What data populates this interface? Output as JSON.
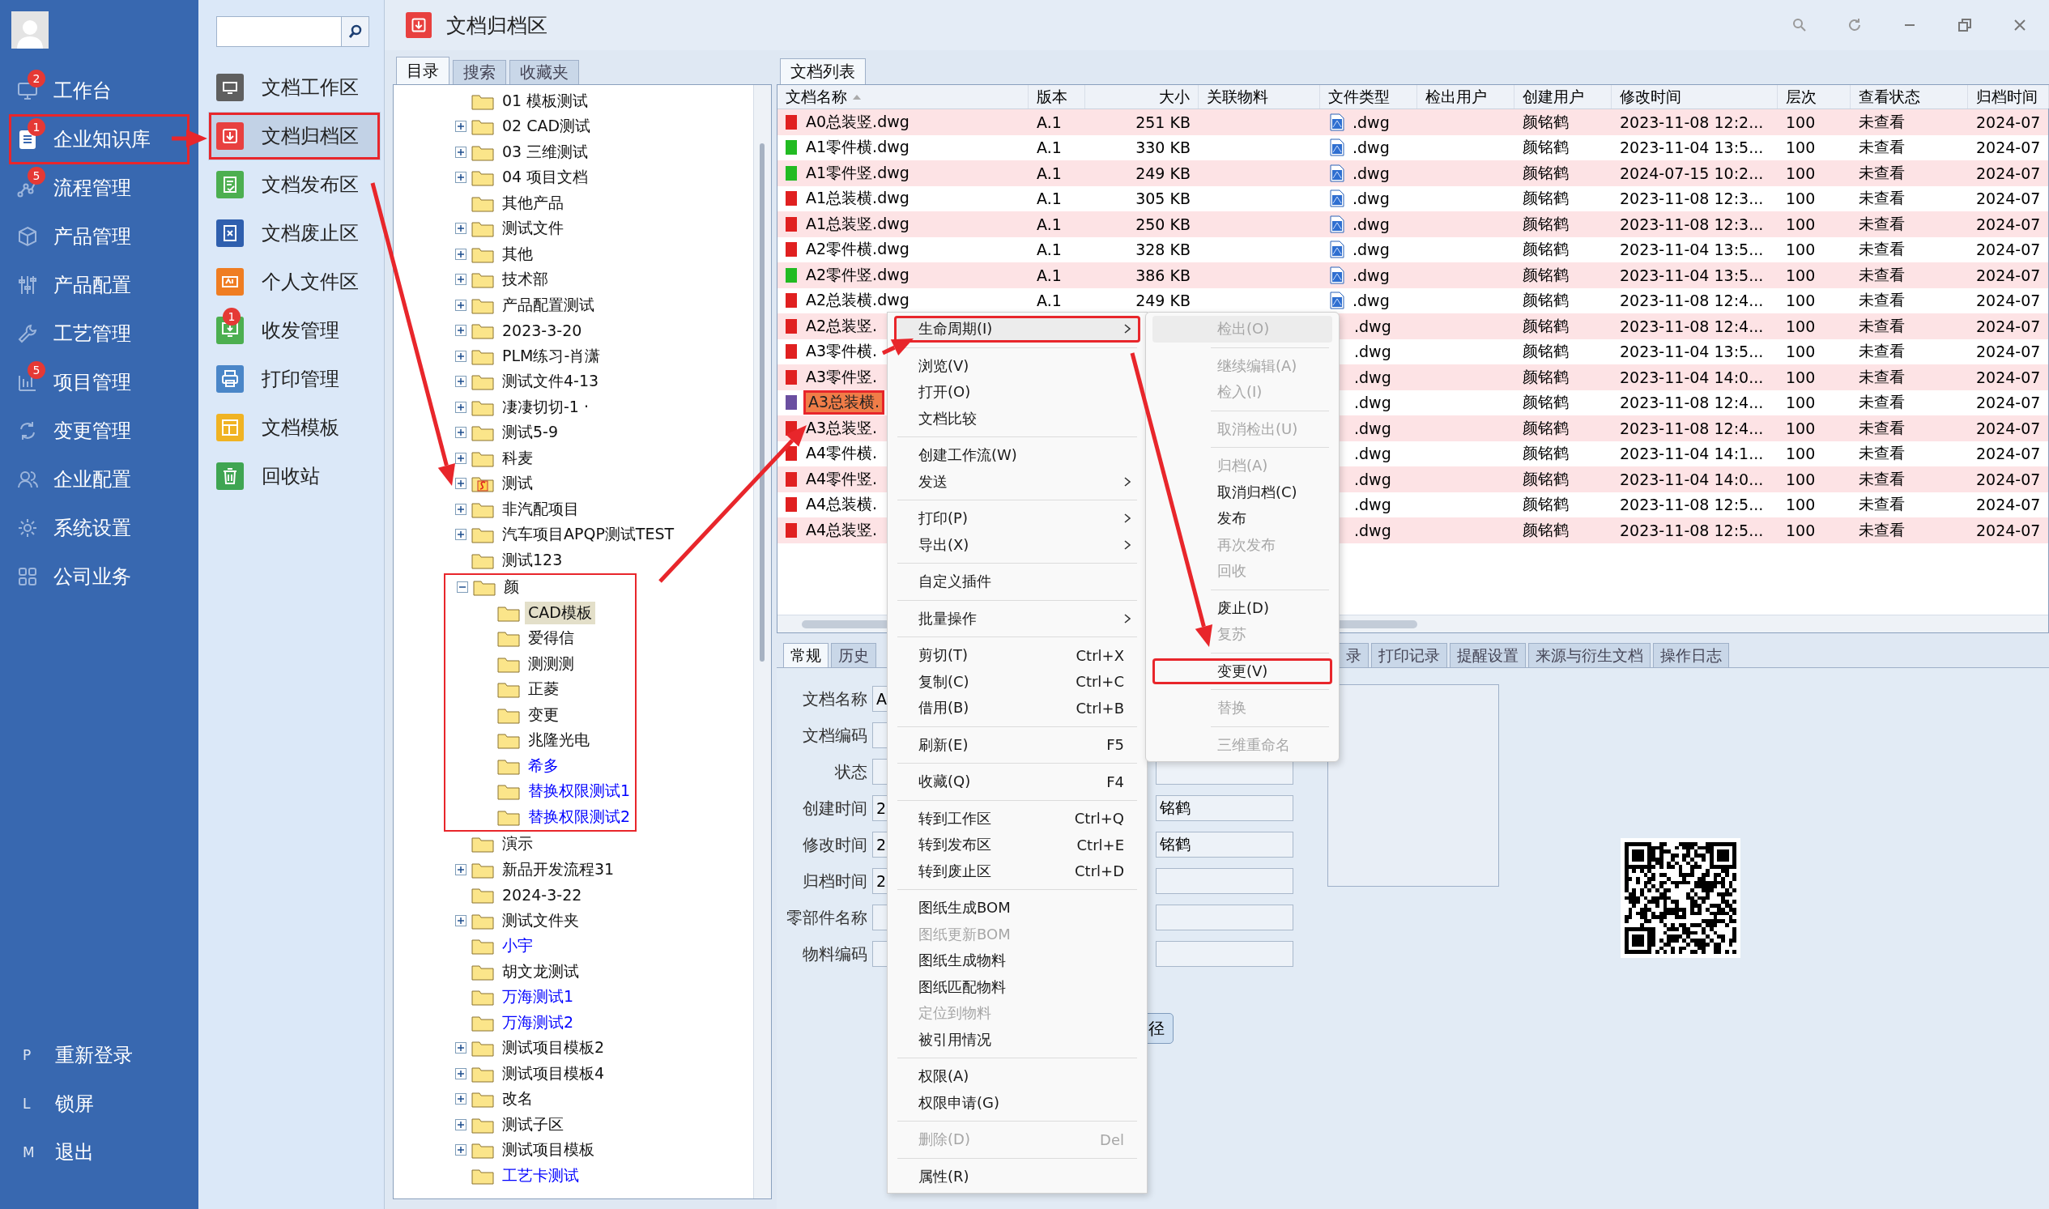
{
  "nav": {
    "items": [
      {
        "label": "工作台",
        "badge": "2",
        "selected": false,
        "annotated": false
      },
      {
        "label": "企业知识库",
        "badge": "1",
        "selected": true,
        "annotated": true
      },
      {
        "label": "流程管理",
        "badge": "5",
        "selected": false,
        "annotated": false
      },
      {
        "label": "产品管理",
        "selected": false,
        "annotated": false
      },
      {
        "label": "产品配置",
        "selected": false,
        "annotated": false
      },
      {
        "label": "工艺管理",
        "selected": false,
        "annotated": false
      },
      {
        "label": "项目管理",
        "badge": "5",
        "selected": false,
        "annotated": false
      },
      {
        "label": "变更管理",
        "selected": false,
        "annotated": false
      },
      {
        "label": "企业配置",
        "selected": false,
        "annotated": false
      },
      {
        "label": "系统设置",
        "selected": false,
        "annotated": false
      },
      {
        "label": "公司业务",
        "selected": false,
        "annotated": false
      }
    ],
    "footer": [
      {
        "key": "P",
        "label": "重新登录"
      },
      {
        "key": "L",
        "label": "锁屏"
      },
      {
        "key": "M",
        "label": "退出"
      }
    ]
  },
  "subnav": {
    "items": [
      {
        "label": "文档工作区",
        "color": "#5f5f5f",
        "selected": false,
        "annotated": false
      },
      {
        "label": "文档归档区",
        "color": "#e8403f",
        "selected": true,
        "annotated": true
      },
      {
        "label": "文档发布区",
        "color": "#4caf50",
        "selected": false,
        "annotated": false
      },
      {
        "label": "文档废止区",
        "color": "#2f5fae",
        "selected": false,
        "annotated": false
      },
      {
        "label": "个人文件区",
        "color": "#ef7d22",
        "selected": false,
        "annotated": false
      },
      {
        "label": "收发管理",
        "color": "#4caf50",
        "badge": "1",
        "selected": false,
        "annotated": false
      },
      {
        "label": "打印管理",
        "color": "#4a86c8",
        "selected": false,
        "annotated": false
      },
      {
        "label": "文档模板",
        "color": "#f0b323",
        "selected": false,
        "annotated": false
      },
      {
        "label": "回收站",
        "color": "#3fa552",
        "selected": false,
        "annotated": false
      }
    ]
  },
  "window": {
    "title": "文档归档区"
  },
  "tree": {
    "tabs": [
      {
        "label": "目录",
        "selected": true
      },
      {
        "label": "搜索",
        "selected": false
      },
      {
        "label": "收藏夹",
        "selected": false
      }
    ],
    "nodes": [
      {
        "label": "01 模板测试",
        "kind": "folder",
        "selected": false
      },
      {
        "label": "02 CAD测试",
        "kind": "folder",
        "expanded": false,
        "selected": false
      },
      {
        "label": "03 三维测试",
        "kind": "folder",
        "expanded": false,
        "selected": false
      },
      {
        "label": "04 项目文档",
        "kind": "folder",
        "expanded": false,
        "selected": false
      },
      {
        "label": "其他产品",
        "kind": "folder",
        "selected": false
      },
      {
        "label": "测试文件",
        "kind": "folder",
        "expanded": false,
        "selected": false
      },
      {
        "label": "其他",
        "kind": "folder",
        "expanded": false,
        "selected": false
      },
      {
        "label": "技术部",
        "kind": "folder",
        "expanded": false,
        "selected": false
      },
      {
        "label": "产品配置测试",
        "kind": "folder",
        "expanded": false,
        "selected": false
      },
      {
        "label": "2023-3-20",
        "kind": "folder",
        "expanded": false,
        "selected": false
      },
      {
        "label": "PLM练习-肖潇",
        "kind": "folder",
        "expanded": false,
        "selected": false
      },
      {
        "label": "测试文件4-13",
        "kind": "folder",
        "expanded": false,
        "selected": false
      },
      {
        "label": "凄凄切切-1 ·",
        "kind": "folder",
        "expanded": false,
        "selected": false
      },
      {
        "label": "测试5-9",
        "kind": "folder",
        "expanded": false,
        "selected": false
      },
      {
        "label": "科麦",
        "kind": "folder",
        "expanded": false,
        "selected": false
      },
      {
        "label": "测试",
        "kind": "special",
        "expanded": false,
        "selected": false
      },
      {
        "label": "非汽配项目",
        "kind": "folder",
        "expanded": false,
        "selected": false
      },
      {
        "label": "汽车项目APQP测试TEST",
        "kind": "folder",
        "expanded": false,
        "selected": false
      },
      {
        "label": "测试123",
        "kind": "folder",
        "selected": false
      },
      {
        "label": "颜",
        "kind": "folder",
        "expanded": true,
        "selected": false,
        "annotated": true,
        "children": [
          {
            "label": "CAD模板",
            "kind": "folder",
            "selected": true
          },
          {
            "label": "爱得信",
            "kind": "folder",
            "selected": false
          },
          {
            "label": "测测测",
            "kind": "folder",
            "selected": false
          },
          {
            "label": "正菱",
            "kind": "folder",
            "selected": false
          },
          {
            "label": "变更",
            "kind": "folder",
            "selected": false
          },
          {
            "label": "兆隆光电",
            "kind": "folder",
            "selected": false
          },
          {
            "label": "希多",
            "kind": "folder",
            "selected": false,
            "color": "#0000ff"
          },
          {
            "label": "替换权限测试1",
            "kind": "folder",
            "selected": false,
            "color": "#0000ff"
          },
          {
            "label": "替换权限测试2",
            "kind": "folder",
            "selected": false,
            "color": "#0000ff"
          }
        ]
      },
      {
        "label": "演示",
        "kind": "folder",
        "selected": false
      },
      {
        "label": "新品开发流程31",
        "kind": "folder",
        "expanded": false,
        "selected": false
      },
      {
        "label": "2024-3-22",
        "kind": "folder",
        "selected": false
      },
      {
        "label": "测试文件夹",
        "kind": "folder",
        "expanded": false,
        "selected": false
      },
      {
        "label": "小宇",
        "kind": "folder",
        "selected": false,
        "color": "#0000ff"
      },
      {
        "label": "胡文龙测试",
        "kind": "folder",
        "selected": false
      },
      {
        "label": "万海测试1",
        "kind": "folder",
        "selected": false,
        "color": "#0000ff"
      },
      {
        "label": "万海测试2",
        "kind": "folder",
        "selected": false,
        "color": "#0000ff"
      },
      {
        "label": "测试项目模板2",
        "kind": "folder",
        "expanded": false,
        "selected": false
      },
      {
        "label": "测试项目模板4",
        "kind": "folder",
        "expanded": false,
        "selected": false
      },
      {
        "label": "改名",
        "kind": "folder",
        "expanded": false,
        "selected": false
      },
      {
        "label": "测试子区",
        "kind": "folder",
        "expanded": false,
        "selected": false
      },
      {
        "label": "测试项目模板",
        "kind": "folder",
        "expanded": false,
        "selected": false
      },
      {
        "label": "工艺卡测试",
        "kind": "folder",
        "selected": false,
        "color": "#0000ff"
      }
    ]
  },
  "list": {
    "tab": "文档列表",
    "columns": [
      "文档名称",
      "版本",
      "大小",
      "关联物料",
      "文件类型",
      "检出用户",
      "创建用户",
      "修改时间",
      "层次",
      "查看状态",
      "归档时间"
    ],
    "rows": [
      {
        "name": "A0总装竖.dwg",
        "color": "#e02020",
        "version": "A.1",
        "size": "251 KB",
        "type": ".dwg",
        "creator": "颜铭鹤",
        "modified": "2023-11-08 12:2...",
        "level": "100",
        "view": "未查看",
        "archived": "2024-07",
        "selected": false
      },
      {
        "name": "A1零件横.dwg",
        "color": "#22bb22",
        "version": "A.1",
        "size": "330 KB",
        "type": ".dwg",
        "creator": "颜铭鹤",
        "modified": "2023-11-04 13:5...",
        "level": "100",
        "view": "未查看",
        "archived": "2024-07",
        "selected": false
      },
      {
        "name": "A1零件竖.dwg",
        "color": "#22bb22",
        "version": "A.1",
        "size": "249 KB",
        "type": ".dwg",
        "creator": "颜铭鹤",
        "modified": "2024-07-15 10:2...",
        "level": "100",
        "view": "未查看",
        "archived": "2024-07",
        "selected": false
      },
      {
        "name": "A1总装横.dwg",
        "color": "#e02020",
        "version": "A.1",
        "size": "305 KB",
        "type": ".dwg",
        "creator": "颜铭鹤",
        "modified": "2023-11-08 12:3...",
        "level": "100",
        "view": "未查看",
        "archived": "2024-07",
        "selected": false
      },
      {
        "name": "A1总装竖.dwg",
        "color": "#e02020",
        "version": "A.1",
        "size": "250 KB",
        "type": ".dwg",
        "creator": "颜铭鹤",
        "modified": "2023-11-08 12:3...",
        "level": "100",
        "view": "未查看",
        "archived": "2024-07",
        "selected": false
      },
      {
        "name": "A2零件横.dwg",
        "color": "#e02020",
        "version": "A.1",
        "size": "328 KB",
        "type": ".dwg",
        "creator": "颜铭鹤",
        "modified": "2023-11-04 13:5...",
        "level": "100",
        "view": "未查看",
        "archived": "2024-07",
        "selected": false
      },
      {
        "name": "A2零件竖.dwg",
        "color": "#22bb22",
        "version": "A.1",
        "size": "386 KB",
        "type": ".dwg",
        "creator": "颜铭鹤",
        "modified": "2023-11-04 13:5...",
        "level": "100",
        "view": "未查看",
        "archived": "2024-07",
        "selected": false
      },
      {
        "name": "A2总装横.dwg",
        "color": "#e02020",
        "version": "A.1",
        "size": "249 KB",
        "type": ".dwg",
        "creator": "颜铭鹤",
        "modified": "2023-11-08 12:4...",
        "level": "100",
        "view": "未查看",
        "archived": "2024-07",
        "selected": false
      },
      {
        "name": "A2总装竖.",
        "color": "#e02020",
        "type": ".dwg",
        "creator": "颜铭鹤",
        "modified": "2023-11-08 12:4...",
        "level": "100",
        "view": "未查看",
        "archived": "2024-07",
        "selected": false
      },
      {
        "name": "A3零件横.",
        "color": "#e02020",
        "type": ".dwg",
        "creator": "颜铭鹤",
        "modified": "2023-11-04 13:5...",
        "level": "100",
        "view": "未查看",
        "archived": "2024-07",
        "selected": false
      },
      {
        "name": "A3零件竖.",
        "color": "#e02020",
        "type": ".dwg",
        "creator": "颜铭鹤",
        "modified": "2023-11-04 14:0...",
        "level": "100",
        "view": "未查看",
        "archived": "2024-07",
        "selected": false
      },
      {
        "name": "A3总装横.",
        "color": "#6a4fa0",
        "type": ".dwg",
        "creator": "颜铭鹤",
        "modified": "2023-11-08 12:4...",
        "level": "100",
        "view": "未查看",
        "archived": "2024-07",
        "selected": true,
        "annotated": true
      },
      {
        "name": "A3总装竖.",
        "color": "#e02020",
        "type": ".dwg",
        "creator": "颜铭鹤",
        "modified": "2023-11-08 12:4...",
        "level": "100",
        "view": "未查看",
        "archived": "2024-07",
        "selected": false
      },
      {
        "name": "A4零件横.",
        "color": "#e02020",
        "type": ".dwg",
        "creator": "颜铭鹤",
        "modified": "2023-11-04 14:1...",
        "level": "100",
        "view": "未查看",
        "archived": "2024-07",
        "selected": false
      },
      {
        "name": "A4零件竖.",
        "color": "#e02020",
        "type": ".dwg",
        "creator": "颜铭鹤",
        "modified": "2023-11-04 14:0...",
        "level": "100",
        "view": "未查看",
        "archived": "2024-07",
        "selected": false
      },
      {
        "name": "A4总装横.",
        "color": "#e02020",
        "type": ".dwg",
        "creator": "颜铭鹤",
        "modified": "2023-11-08 12:5...",
        "level": "100",
        "view": "未查看",
        "archived": "2024-07",
        "selected": false
      },
      {
        "name": "A4总装竖.",
        "color": "#e02020",
        "type": ".dwg",
        "creator": "颜铭鹤",
        "modified": "2023-11-08 12:5...",
        "level": "100",
        "view": "未查看",
        "archived": "2024-07",
        "selected": false
      }
    ]
  },
  "detail": {
    "tabs": [
      {
        "label": "常规",
        "selected": true
      },
      {
        "label": "历史",
        "selected": false
      },
      {
        "label": "录",
        "selected": false
      },
      {
        "label": "打印记录",
        "selected": false
      },
      {
        "label": "提醒设置",
        "selected": false
      },
      {
        "label": "来源与衍生文档",
        "selected": false
      },
      {
        "label": "操作日志",
        "selected": false
      }
    ],
    "fields": [
      {
        "label": "文档名称",
        "value": "A",
        "right_field": false
      },
      {
        "label": "文档编码",
        "right_field": false
      },
      {
        "label": "状态",
        "right_field": true
      },
      {
        "label": "创建时间",
        "value": "2",
        "right_field": true,
        "right_value": "铭鹤"
      },
      {
        "label": "修改时间",
        "value": "2",
        "right_field": true,
        "right_value": "铭鹤"
      },
      {
        "label": "归档时间",
        "value": "2",
        "right_field": true
      },
      {
        "label": "零部件名称",
        "right_field": true
      },
      {
        "label": "物料编码",
        "right_field": true
      }
    ],
    "path_button": "径"
  },
  "context_menu": {
    "items": [
      {
        "kind": "item",
        "label": "生命周期(I)",
        "submenu": true,
        "selected": true,
        "disabled": false,
        "annotated": true
      },
      {
        "kind": "separator"
      },
      {
        "kind": "item",
        "label": "浏览(V)",
        "selected": false,
        "disabled": false
      },
      {
        "kind": "item",
        "label": "打开(O)",
        "selected": false,
        "disabled": false
      },
      {
        "kind": "item",
        "label": "文档比较",
        "selected": false,
        "disabled": false
      },
      {
        "kind": "separator"
      },
      {
        "kind": "item",
        "label": "创建工作流(W)",
        "selected": false,
        "disabled": false
      },
      {
        "kind": "item",
        "label": "发送",
        "submenu": true,
        "selected": false,
        "disabled": false
      },
      {
        "kind": "separator"
      },
      {
        "kind": "item",
        "label": "打印(P)",
        "submenu": true,
        "selected": false,
        "disabled": false
      },
      {
        "kind": "item",
        "label": "导出(X)",
        "submenu": true,
        "selected": false,
        "disabled": false
      },
      {
        "kind": "separator"
      },
      {
        "kind": "item",
        "label": "自定义插件",
        "selected": false,
        "disabled": false
      },
      {
        "kind": "separator"
      },
      {
        "kind": "item",
        "label": "批量操作",
        "submenu": true,
        "selected": false,
        "disabled": false
      },
      {
        "kind": "separator"
      },
      {
        "kind": "item",
        "label": "剪切(T)",
        "shortcut": "Ctrl+X",
        "selected": false,
        "disabled": false
      },
      {
        "kind": "item",
        "label": "复制(C)",
        "shortcut": "Ctrl+C",
        "selected": false,
        "disabled": false
      },
      {
        "kind": "item",
        "label": "借用(B)",
        "shortcut": "Ctrl+B",
        "selected": false,
        "disabled": false
      },
      {
        "kind": "separator"
      },
      {
        "kind": "item",
        "label": "刷新(E)",
        "shortcut": "F5",
        "selected": false,
        "disabled": false
      },
      {
        "kind": "separator"
      },
      {
        "kind": "item",
        "label": "收藏(Q)",
        "shortcut": "F4",
        "selected": false,
        "disabled": false
      },
      {
        "kind": "separator"
      },
      {
        "kind": "item",
        "label": "转到工作区",
        "shortcut": "Ctrl+Q",
        "selected": false,
        "disabled": false
      },
      {
        "kind": "item",
        "label": "转到发布区",
        "shortcut": "Ctrl+E",
        "selected": false,
        "disabled": false
      },
      {
        "kind": "item",
        "label": "转到废止区",
        "shortcut": "Ctrl+D",
        "selected": false,
        "disabled": false
      },
      {
        "kind": "separator"
      },
      {
        "kind": "item",
        "label": "图纸生成BOM",
        "selected": false,
        "disabled": false
      },
      {
        "kind": "item",
        "label": "图纸更新BOM",
        "selected": false,
        "disabled": true
      },
      {
        "kind": "item",
        "label": "图纸生成物料",
        "selected": false,
        "disabled": false
      },
      {
        "kind": "item",
        "label": "图纸匹配物料",
        "selected": false,
        "disabled": false
      },
      {
        "kind": "item",
        "label": "定位到物料",
        "selected": false,
        "disabled": true
      },
      {
        "kind": "item",
        "label": "被引用情况",
        "selected": false,
        "disabled": false
      },
      {
        "kind": "separator"
      },
      {
        "kind": "item",
        "label": "权限(A)",
        "selected": false,
        "disabled": false
      },
      {
        "kind": "item",
        "label": "权限申请(G)",
        "selected": false,
        "disabled": false
      },
      {
        "kind": "separator"
      },
      {
        "kind": "item",
        "label": "删除(D)",
        "shortcut": "Del",
        "selected": false,
        "disabled": true
      },
      {
        "kind": "separator"
      },
      {
        "kind": "item",
        "label": "属性(R)",
        "selected": false,
        "disabled": false
      }
    ],
    "submenu": [
      {
        "kind": "item",
        "label": "检出(O)",
        "selected": true,
        "disabled": true
      },
      {
        "kind": "separator"
      },
      {
        "kind": "item",
        "label": "继续编辑(A)",
        "selected": false,
        "disabled": true
      },
      {
        "kind": "item",
        "label": "检入(I)",
        "selected": false,
        "disabled": true
      },
      {
        "kind": "separator"
      },
      {
        "kind": "item",
        "label": "取消检出(U)",
        "selected": false,
        "disabled": true
      },
      {
        "kind": "separator"
      },
      {
        "kind": "item",
        "label": "归档(A)",
        "selected": false,
        "disabled": true
      },
      {
        "kind": "item",
        "label": "取消归档(C)",
        "selected": false,
        "disabled": false
      },
      {
        "kind": "item",
        "label": "发布",
        "selected": false,
        "disabled": false
      },
      {
        "kind": "item",
        "label": "再次发布",
        "selected": false,
        "disabled": true
      },
      {
        "kind": "item",
        "label": "回收",
        "selected": false,
        "disabled": true
      },
      {
        "kind": "separator"
      },
      {
        "kind": "item",
        "label": "废止(D)",
        "selected": false,
        "disabled": false
      },
      {
        "kind": "item",
        "label": "复苏",
        "selected": false,
        "disabled": true
      },
      {
        "kind": "separator"
      },
      {
        "kind": "item",
        "label": "变更(V)",
        "selected": false,
        "disabled": false,
        "annotated": true
      },
      {
        "kind": "separator"
      },
      {
        "kind": "item",
        "label": "替换",
        "selected": false,
        "disabled": true
      },
      {
        "kind": "separator"
      },
      {
        "kind": "item",
        "label": "三维重命名",
        "selected": false,
        "disabled": true
      }
    ]
  }
}
